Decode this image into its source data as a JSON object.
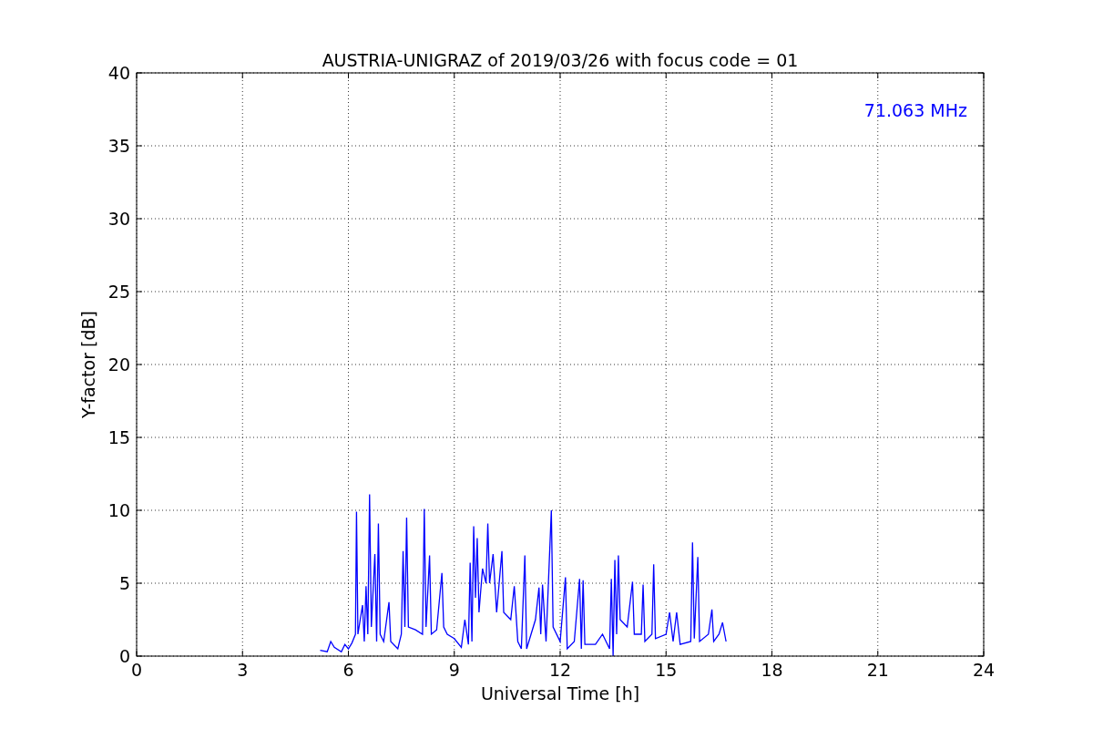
{
  "chart_data": {
    "type": "line",
    "title": "AUSTRIA-UNIGRAZ of 2019/03/26 with focus code = 01",
    "xlabel": "Universal Time [h]",
    "ylabel": "Y-factor [dB]",
    "xlim": [
      0,
      24
    ],
    "ylim": [
      0,
      40
    ],
    "xticks": [
      0,
      3,
      6,
      9,
      12,
      15,
      18,
      21,
      24
    ],
    "yticks": [
      0,
      5,
      10,
      15,
      20,
      25,
      30,
      35,
      40
    ],
    "grid": true,
    "annotations": [
      {
        "text": "71.063 MHz"
      }
    ],
    "x": [
      5.2,
      5.4,
      5.5,
      5.6,
      5.8,
      5.9,
      6.0,
      6.1,
      6.2,
      6.23,
      6.27,
      6.4,
      6.45,
      6.5,
      6.55,
      6.6,
      6.65,
      6.75,
      6.8,
      6.85,
      6.9,
      7.0,
      7.15,
      7.2,
      7.4,
      7.5,
      7.55,
      7.6,
      7.65,
      7.7,
      7.9,
      8.1,
      8.15,
      8.2,
      8.3,
      8.35,
      8.5,
      8.65,
      8.7,
      8.8,
      9.0,
      9.2,
      9.3,
      9.4,
      9.45,
      9.5,
      9.55,
      9.6,
      9.65,
      9.7,
      9.8,
      9.9,
      9.95,
      10.0,
      10.1,
      10.2,
      10.35,
      10.4,
      10.6,
      10.7,
      10.8,
      10.9,
      11.0,
      11.05,
      11.3,
      11.4,
      11.45,
      11.5,
      11.6,
      11.75,
      11.8,
      12.0,
      12.15,
      12.2,
      12.4,
      12.55,
      12.6,
      12.65,
      12.7,
      13.0,
      13.2,
      13.4,
      13.45,
      13.5,
      13.55,
      13.6,
      13.65,
      13.7,
      13.9,
      14.05,
      14.1,
      14.3,
      14.35,
      14.4,
      14.6,
      14.65,
      14.7,
      15.0,
      15.1,
      15.2,
      15.3,
      15.4,
      15.7,
      15.75,
      15.8,
      15.9,
      15.95,
      16.2,
      16.3,
      16.35,
      16.5,
      16.6,
      16.7
    ],
    "series": [
      {
        "color": "#0000ff",
        "values": [
          0.4,
          0.3,
          1.0,
          0.6,
          0.3,
          0.8,
          0.5,
          0.9,
          1.5,
          9.9,
          1.5,
          3.5,
          1.0,
          4.8,
          1.5,
          11.1,
          2.0,
          7.0,
          1.0,
          9.1,
          1.5,
          1.0,
          3.7,
          1.0,
          0.5,
          1.5,
          7.2,
          2.0,
          9.5,
          2.0,
          1.8,
          1.5,
          10.1,
          2.0,
          6.9,
          1.5,
          1.8,
          5.7,
          2.0,
          1.5,
          1.2,
          0.6,
          2.5,
          0.8,
          6.4,
          1.0,
          8.9,
          4.0,
          8.1,
          3.0,
          6.0,
          5.0,
          9.1,
          5.0,
          7.0,
          3.0,
          7.2,
          3.0,
          2.5,
          4.8,
          1.0,
          0.5,
          6.9,
          0.5,
          2.5,
          4.7,
          1.5,
          4.9,
          1.0,
          10.0,
          2.0,
          1.0,
          5.4,
          0.5,
          1.0,
          5.3,
          0.5,
          5.2,
          0.8,
          0.8,
          1.5,
          0.5,
          5.3,
          0.0,
          6.6,
          1.5,
          6.9,
          2.5,
          2.0,
          5.1,
          1.5,
          1.5,
          4.9,
          1.0,
          1.5,
          6.3,
          1.2,
          1.5,
          3.0,
          1.0,
          3.0,
          0.8,
          1.0,
          7.8,
          1.2,
          6.8,
          1.0,
          1.5,
          3.2,
          1.0,
          1.5,
          2.3,
          1.0
        ]
      }
    ]
  }
}
